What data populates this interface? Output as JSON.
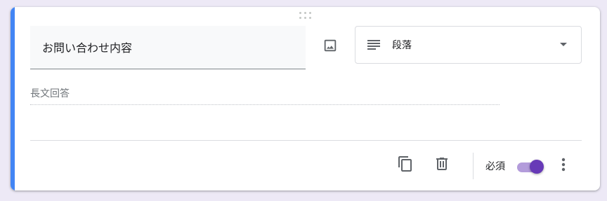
{
  "colors": {
    "accent_bar": "#4285f4",
    "toggle_on": "#673ab7",
    "page_background": "#ede9f6"
  },
  "question": {
    "title_value": "お問い合わせ内容",
    "image_icon": "image-icon",
    "type_icon": "paragraph-lines-icon",
    "type_label": "段落",
    "answer_placeholder": "長文回答"
  },
  "footer": {
    "copy_icon": "copy-icon",
    "delete_icon": "trash-icon",
    "required_label": "必須",
    "required_on": true,
    "more_icon": "more-vert-icon"
  }
}
